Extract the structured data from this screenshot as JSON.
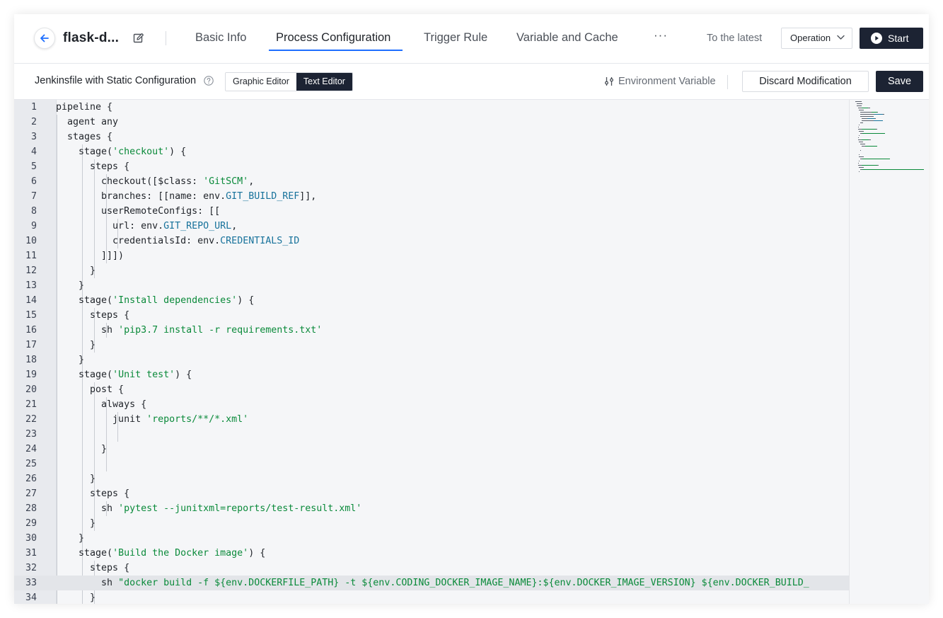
{
  "header": {
    "project_name": "flask-d...",
    "tabs": [
      {
        "label": "Basic Info"
      },
      {
        "label": "Process Configuration"
      },
      {
        "label": "Trigger Rule"
      },
      {
        "label": "Variable and Cache"
      }
    ],
    "more_label": "···",
    "to_latest_label": "To the latest",
    "operation_label": "Operation",
    "start_label": "Start"
  },
  "toolbar": {
    "title": "Jenkinsfile with Static Configuration",
    "graphic_editor_label": "Graphic Editor",
    "text_editor_label": "Text Editor",
    "env_var_label": "Environment Variable",
    "discard_label": "Discard Modification",
    "save_label": "Save"
  },
  "colors": {
    "accent": "#1e6fff",
    "primary_button": "#1c2333",
    "string": "#0a8a3a",
    "variable": "#17729b"
  },
  "editor": {
    "highlighted_line": 33,
    "lines": [
      {
        "n": "1",
        "segs": [
          {
            "t": "pipeline {",
            "c": ""
          }
        ]
      },
      {
        "n": "2",
        "segs": [
          {
            "t": "  agent any",
            "c": ""
          }
        ]
      },
      {
        "n": "3",
        "segs": [
          {
            "t": "  stages {",
            "c": ""
          }
        ]
      },
      {
        "n": "4",
        "segs": [
          {
            "t": "    stage(",
            "c": ""
          },
          {
            "t": "'checkout'",
            "c": "s"
          },
          {
            "t": ") {",
            "c": ""
          }
        ]
      },
      {
        "n": "5",
        "segs": [
          {
            "t": "      steps {",
            "c": ""
          }
        ]
      },
      {
        "n": "6",
        "segs": [
          {
            "t": "        checkout([$class: ",
            "c": ""
          },
          {
            "t": "'GitSCM'",
            "c": "s"
          },
          {
            "t": ",",
            "c": ""
          }
        ]
      },
      {
        "n": "7",
        "segs": [
          {
            "t": "        branches: [[name: env.",
            "c": ""
          },
          {
            "t": "GIT_BUILD_REF",
            "c": "v"
          },
          {
            "t": "]],",
            "c": ""
          }
        ]
      },
      {
        "n": "8",
        "segs": [
          {
            "t": "        userRemoteConfigs: [[",
            "c": ""
          }
        ]
      },
      {
        "n": "9",
        "segs": [
          {
            "t": "          url: env.",
            "c": ""
          },
          {
            "t": "GIT_REPO_URL",
            "c": "v"
          },
          {
            "t": ",",
            "c": ""
          }
        ]
      },
      {
        "n": "10",
        "segs": [
          {
            "t": "          credentialsId: env.",
            "c": ""
          },
          {
            "t": "CREDENTIALS_ID",
            "c": "v"
          }
        ]
      },
      {
        "n": "11",
        "segs": [
          {
            "t": "        ]]])",
            "c": ""
          }
        ]
      },
      {
        "n": "12",
        "segs": [
          {
            "t": "      }",
            "c": ""
          }
        ]
      },
      {
        "n": "13",
        "segs": [
          {
            "t": "    }",
            "c": ""
          }
        ]
      },
      {
        "n": "14",
        "segs": [
          {
            "t": "    stage(",
            "c": ""
          },
          {
            "t": "'Install dependencies'",
            "c": "s"
          },
          {
            "t": ") {",
            "c": ""
          }
        ]
      },
      {
        "n": "15",
        "segs": [
          {
            "t": "      steps {",
            "c": ""
          }
        ]
      },
      {
        "n": "16",
        "segs": [
          {
            "t": "        sh ",
            "c": ""
          },
          {
            "t": "'pip3.7 install -r requirements.txt'",
            "c": "s"
          }
        ]
      },
      {
        "n": "17",
        "segs": [
          {
            "t": "      }",
            "c": ""
          }
        ]
      },
      {
        "n": "18",
        "segs": [
          {
            "t": "    }",
            "c": ""
          }
        ]
      },
      {
        "n": "19",
        "segs": [
          {
            "t": "    stage(",
            "c": ""
          },
          {
            "t": "'Unit test'",
            "c": "s"
          },
          {
            "t": ") {",
            "c": ""
          }
        ]
      },
      {
        "n": "20",
        "segs": [
          {
            "t": "      post {",
            "c": ""
          }
        ]
      },
      {
        "n": "21",
        "segs": [
          {
            "t": "        always {",
            "c": ""
          }
        ]
      },
      {
        "n": "22",
        "segs": [
          {
            "t": "          junit ",
            "c": ""
          },
          {
            "t": "'reports/**/*.xml'",
            "c": "s"
          }
        ]
      },
      {
        "n": "23",
        "segs": [
          {
            "t": "",
            "c": ""
          }
        ]
      },
      {
        "n": "24",
        "segs": [
          {
            "t": "        }",
            "c": ""
          }
        ]
      },
      {
        "n": "25",
        "segs": [
          {
            "t": "",
            "c": ""
          }
        ]
      },
      {
        "n": "26",
        "segs": [
          {
            "t": "      }",
            "c": ""
          }
        ]
      },
      {
        "n": "27",
        "segs": [
          {
            "t": "      steps {",
            "c": ""
          }
        ]
      },
      {
        "n": "28",
        "segs": [
          {
            "t": "        sh ",
            "c": ""
          },
          {
            "t": "'pytest --junitxml=reports/test-result.xml'",
            "c": "s"
          }
        ]
      },
      {
        "n": "29",
        "segs": [
          {
            "t": "      }",
            "c": ""
          }
        ]
      },
      {
        "n": "30",
        "segs": [
          {
            "t": "    }",
            "c": ""
          }
        ]
      },
      {
        "n": "31",
        "segs": [
          {
            "t": "    stage(",
            "c": ""
          },
          {
            "t": "'Build the Docker image'",
            "c": "s"
          },
          {
            "t": ") {",
            "c": ""
          }
        ]
      },
      {
        "n": "32",
        "segs": [
          {
            "t": "      steps {",
            "c": ""
          }
        ]
      },
      {
        "n": "33",
        "segs": [
          {
            "t": "        sh ",
            "c": ""
          },
          {
            "t": "\"docker build -f ${env.DOCKERFILE_PATH} -t ${env.CODING_DOCKER_IMAGE_NAME}:${env.DOCKER_IMAGE_VERSION} ${env.DOCKER_BUILD_",
            "c": "s"
          }
        ]
      },
      {
        "n": "34",
        "segs": [
          {
            "t": "      }",
            "c": ""
          }
        ]
      }
    ]
  }
}
